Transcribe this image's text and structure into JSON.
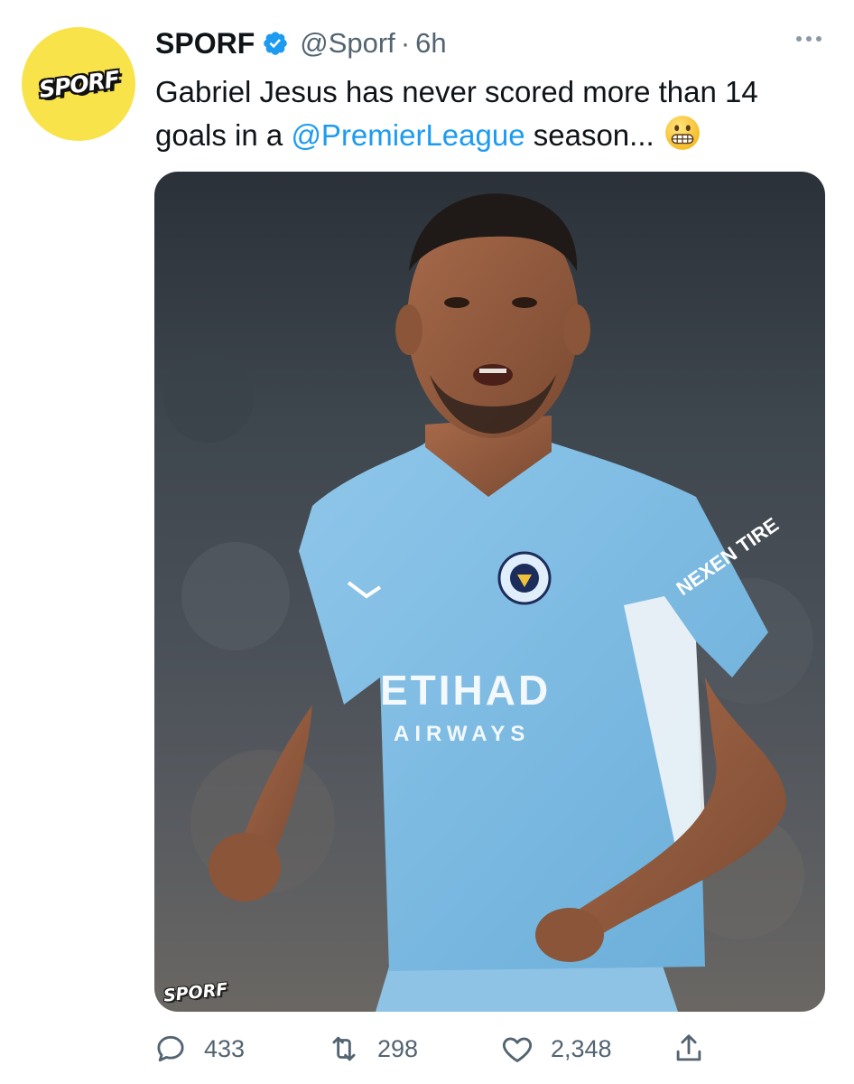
{
  "tweet": {
    "display_name": "SPORF",
    "handle": "@Sporf",
    "separator": "·",
    "time": "6h",
    "text_part1": "Gabriel Jesus has never scored more than 14 goals in a ",
    "mention": "@PremierLeague",
    "text_part2": " season...",
    "emoji": "grimacing-face-emoji"
  },
  "avatar": {
    "text": "SPORF",
    "bg_color": "#f9e34a"
  },
  "media": {
    "watermark": "SPORF",
    "shirt_sponsor_line1": "ETIHAD",
    "shirt_sponsor_line2": "AIRWAYS",
    "sleeve_text": "NEXEN TIRE",
    "crest_text": "MANCHESTER CITY"
  },
  "actions": {
    "replies": "433",
    "retweets": "298",
    "likes": "2,348"
  },
  "colors": {
    "accent": "#1d9bf0",
    "secondary_text": "#536471",
    "primary_text": "#0f1419",
    "verified": "#1d9bf0"
  }
}
